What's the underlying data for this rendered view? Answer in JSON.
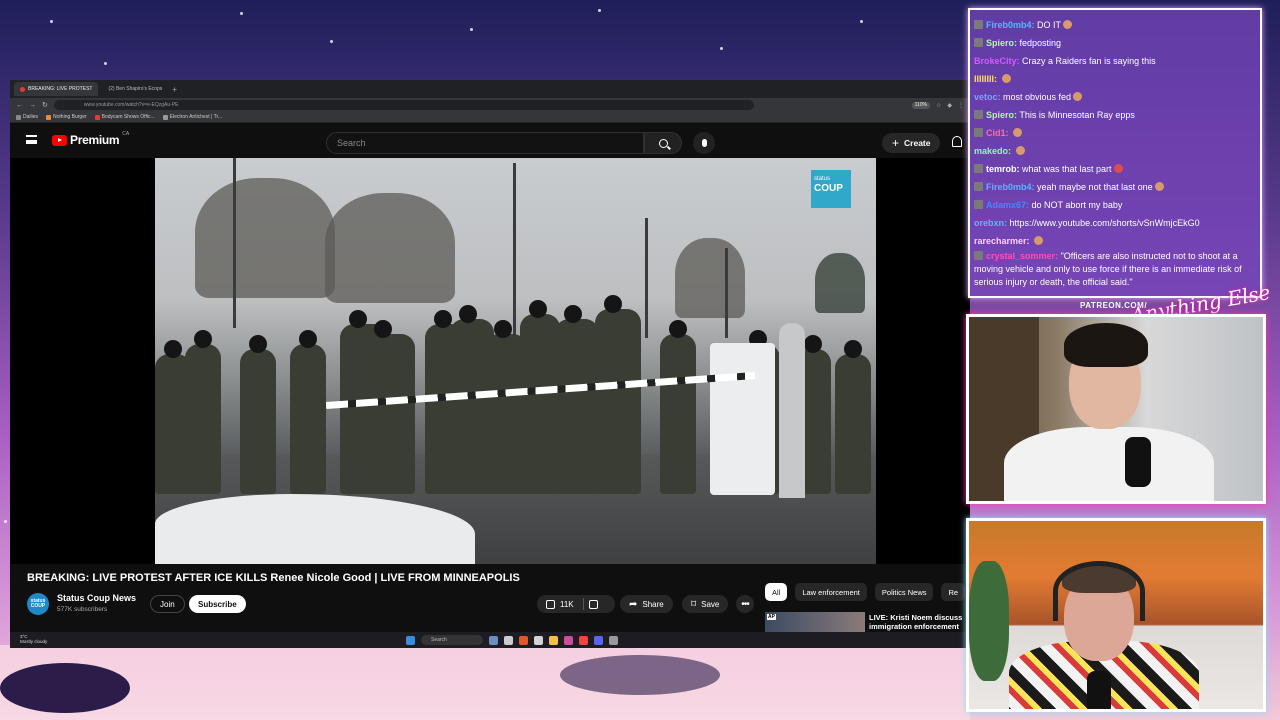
{
  "browser": {
    "tabs": [
      {
        "label": "BREAKING: LIVE PROTEST"
      },
      {
        "label": "(2) Ben Shapiro's Ecops"
      }
    ],
    "url": "www.youtube.com/watch?v=e-EQzgAu-PE",
    "zoom": "110%",
    "bookmarks": [
      "Dailies",
      "Nothing Burger",
      "Bodycam Shows Offic...",
      "Electron Antichest | Tr..."
    ]
  },
  "youtube": {
    "logo": "Premium",
    "logo_region": "CA",
    "search_placeholder": "Search",
    "create_label": "Create",
    "video": {
      "title": "BREAKING: LIVE PROTEST AFTER ICE KILLS Renee Nicole Good | LIVE FROM MINNEAPOLIS",
      "watermark_top": "status",
      "watermark_main": "COUP"
    },
    "channel": {
      "name": "Status Coup News",
      "subscribers": "577K subscribers",
      "avatar_text": "status COUP"
    },
    "actions": {
      "join": "Join",
      "subscribe": "Subscribe",
      "likes": "11K",
      "share": "Share",
      "save": "Save",
      "more": "•••"
    },
    "chips": [
      "All",
      "Law enforcement",
      "Politics News",
      "Re"
    ],
    "recommendation": {
      "title_line1": "LIVE: Kristi Noem discuss",
      "title_line2": "immigration enforcement",
      "badge": "AP"
    }
  },
  "taskbar": {
    "temperature": "3°C",
    "weather": "Mostly cloudy",
    "search": "Search"
  },
  "chat": {
    "messages": [
      {
        "user": "Fireb0mb4:",
        "user_color": "#56b7ff",
        "text": "DO IT"
      },
      {
        "user": "Spiero:",
        "user_color": "#a6ff9b",
        "text": "fedposting"
      },
      {
        "user": "BrokeCity:",
        "user_color": "#d45bff",
        "text": "Crazy a Raiders fan is saying this"
      },
      {
        "user": "IIIIIIII:",
        "user_color": "#ffe14d",
        "text": ""
      },
      {
        "user": "vetoc:",
        "user_color": "#6fa8ff",
        "text": "most obvious fed"
      },
      {
        "user": "Spiero:",
        "user_color": "#a6ff9b",
        "text": "This is Minnesotan Ray epps"
      },
      {
        "user": "Cid1:",
        "user_color": "#ff6da0",
        "text": ""
      },
      {
        "user": "makedo:",
        "user_color": "#8fff9d",
        "text": ""
      },
      {
        "user": "temrob:",
        "user_color": "#ffffff",
        "text": "what was that last part"
      },
      {
        "user": "Fireb0mb4:",
        "user_color": "#56b7ff",
        "text": "yeah maybe not that last one"
      },
      {
        "user": "Adamx67:",
        "user_color": "#3b8cff",
        "text": "do NOT abort my baby"
      },
      {
        "user": "orebxn:",
        "user_color": "#6ab0ff",
        "text": "https://www.youtube.com/shorts/vSnWmjcEkG0"
      },
      {
        "user": "rarecharmer:",
        "user_color": "#ffd0f5",
        "text": ""
      },
      {
        "user": "crystal_sommer:",
        "user_color": "#ff4fb0",
        "text": "\"Officers are also instructed not to shoot at a moving vehicle and only to use force if there is an immediate risk of serious injury or death, the official said.\""
      }
    ]
  },
  "overlay": {
    "patreon": "PATREON.COM/",
    "signature": "Anything Else"
  }
}
